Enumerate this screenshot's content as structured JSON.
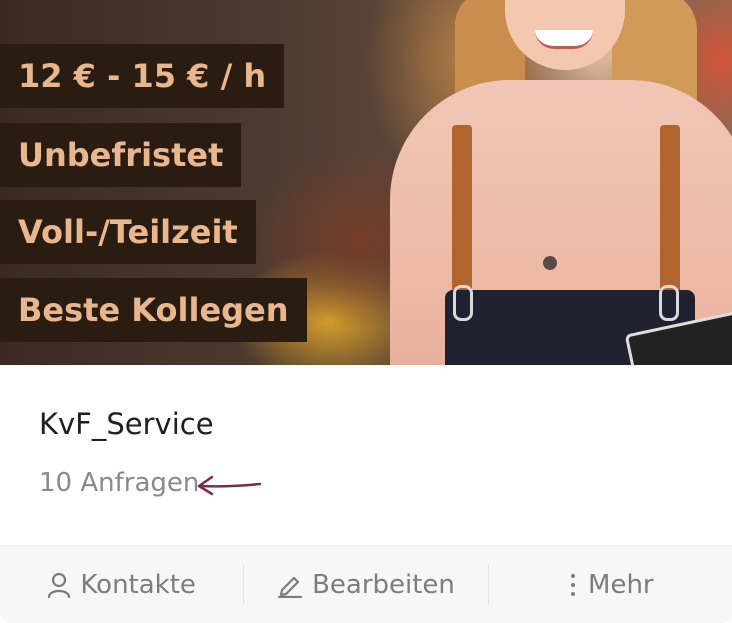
{
  "hero": {
    "tags": [
      "12 € - 15 € / h",
      "Unbefristet",
      "Voll-/Teilzeit",
      "Beste Kollegen"
    ]
  },
  "listing": {
    "title": "KvF_Service",
    "requests": "10 Anfragen",
    "arrow_color": "#7a2c4f"
  },
  "footer": {
    "contacts_label": "Kontakte",
    "contacts_icon": "user-icon",
    "edit_label": "Bearbeiten",
    "edit_icon": "pencil-icon",
    "more_label": "Mehr",
    "more_icon": "vertical-dots-icon"
  }
}
